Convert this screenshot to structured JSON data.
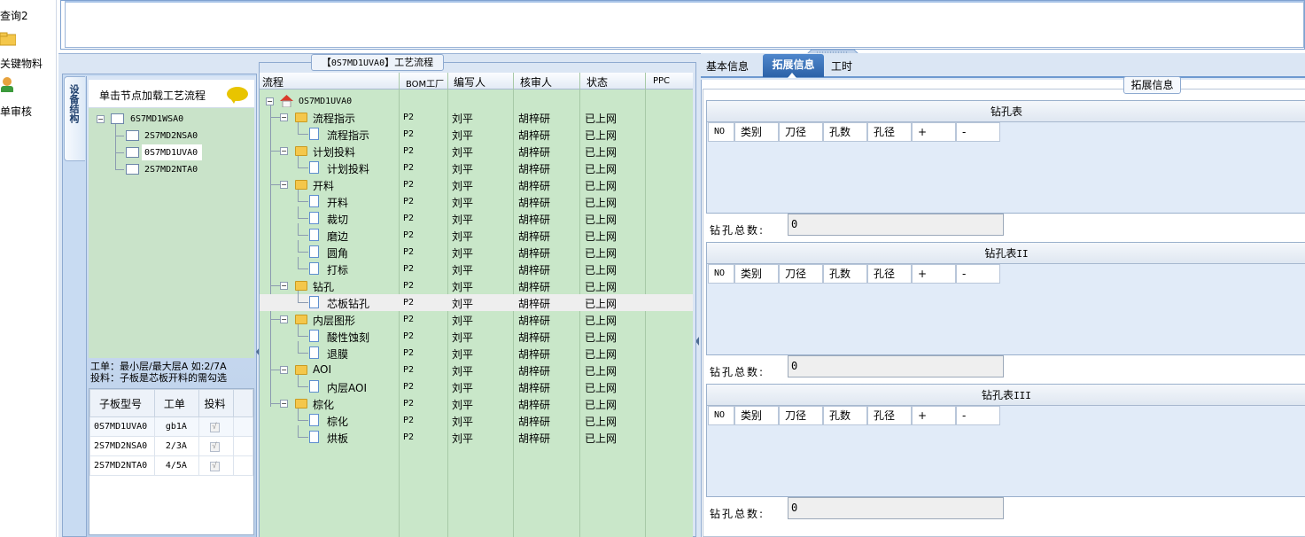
{
  "nav": {
    "items": [
      {
        "label": "查询2",
        "icon": "search-icon"
      },
      {
        "label": "关键物料",
        "icon": "folder-icon"
      },
      {
        "label": "单审核",
        "icon": "user-icon"
      }
    ]
  },
  "left_panel": {
    "vertical_tab": "设备结构",
    "hint": "单击节点加载工艺流程",
    "tree": {
      "root": "6S7MD1WSA0",
      "children": [
        "2S7MD2NSA0",
        "0S7MD1UVA0",
        "2S7MD2NTA0"
      ]
    },
    "note_line1": "工单：最小层/最大层A 如:2/7A",
    "note_line2": "投料：子板是芯板开料的需勾选",
    "table": {
      "headers": [
        "子板型号",
        "工单",
        "投料"
      ],
      "rows": [
        {
          "model": "0S7MD1UVA0",
          "order": "gb1A",
          "feed": "√"
        },
        {
          "model": "2S7MD2NSA0",
          "order": "2/3A",
          "feed": "√"
        },
        {
          "model": "2S7MD2NTA0",
          "order": "4/5A",
          "feed": "√"
        }
      ]
    }
  },
  "mid_panel": {
    "title_prefix": "【",
    "title_code": "0S7MD1UVA0",
    "title_suffix": "】工艺流程",
    "columns": [
      "流程",
      "BOM工厂",
      "编写人",
      "核审人",
      "状态",
      "PPC"
    ],
    "root": "OS7MD1UVA0",
    "rows": [
      {
        "name": "流程指示",
        "bom": "P2",
        "writer": "刘平",
        "reviewer": "胡梓研",
        "status": "已上网"
      },
      {
        "name": "流程指示",
        "bom": "P2",
        "writer": "刘平",
        "reviewer": "胡梓研",
        "status": "已上网"
      },
      {
        "name": "计划投料",
        "bom": "P2",
        "writer": "刘平",
        "reviewer": "胡梓研",
        "status": "已上网"
      },
      {
        "name": "计划投料",
        "bom": "P2",
        "writer": "刘平",
        "reviewer": "胡梓研",
        "status": "已上网"
      },
      {
        "name": "开料",
        "bom": "P2",
        "writer": "刘平",
        "reviewer": "胡梓研",
        "status": "已上网"
      },
      {
        "name": "开料",
        "bom": "P2",
        "writer": "刘平",
        "reviewer": "胡梓研",
        "status": "已上网"
      },
      {
        "name": "裁切",
        "bom": "P2",
        "writer": "刘平",
        "reviewer": "胡梓研",
        "status": "已上网"
      },
      {
        "name": "磨边",
        "bom": "P2",
        "writer": "刘平",
        "reviewer": "胡梓研",
        "status": "已上网"
      },
      {
        "name": "圆角",
        "bom": "P2",
        "writer": "刘平",
        "reviewer": "胡梓研",
        "status": "已上网"
      },
      {
        "name": "打标",
        "bom": "P2",
        "writer": "刘平",
        "reviewer": "胡梓研",
        "status": "已上网"
      },
      {
        "name": "钻孔",
        "bom": "P2",
        "writer": "刘平",
        "reviewer": "胡梓研",
        "status": "已上网"
      },
      {
        "name": "芯板钻孔",
        "bom": "P2",
        "writer": "刘平",
        "reviewer": "胡梓研",
        "status": "已上网"
      },
      {
        "name": "内层图形",
        "bom": "P2",
        "writer": "刘平",
        "reviewer": "胡梓研",
        "status": "已上网"
      },
      {
        "name": "酸性蚀刻",
        "bom": "P2",
        "writer": "刘平",
        "reviewer": "胡梓研",
        "status": "已上网"
      },
      {
        "name": "退膜",
        "bom": "P2",
        "writer": "刘平",
        "reviewer": "胡梓研",
        "status": "已上网"
      },
      {
        "name": "AOI",
        "bom": "P2",
        "writer": "刘平",
        "reviewer": "胡梓研",
        "status": "已上网"
      },
      {
        "name": "内层AOI",
        "bom": "P2",
        "writer": "刘平",
        "reviewer": "胡梓研",
        "status": "已上网"
      },
      {
        "name": "棕化",
        "bom": "P2",
        "writer": "刘平",
        "reviewer": "胡梓研",
        "status": "已上网"
      },
      {
        "name": "棕化",
        "bom": "P2",
        "writer": "刘平",
        "reviewer": "胡梓研",
        "status": "已上网"
      },
      {
        "name": "烘板",
        "bom": "P2",
        "writer": "刘平",
        "reviewer": "胡梓研",
        "status": "已上网"
      }
    ]
  },
  "right_panel": {
    "tabs": [
      "基本信息",
      "拓展信息",
      "工时"
    ],
    "active_tab": "拓展信息",
    "group_title": "拓展信息",
    "columns": [
      "NO",
      "类别",
      "刀径",
      "孔数",
      "孔径",
      "+",
      "-"
    ],
    "total_label": "钻孔总数:",
    "sections": [
      {
        "title": "钻孔表",
        "suffix": "",
        "total": "0"
      },
      {
        "title": "钻孔表",
        "suffix": "II",
        "total": "0"
      },
      {
        "title": "钻孔表",
        "suffix": "III",
        "total": "0"
      }
    ]
  },
  "colors": {
    "accent": "#2c62a8",
    "grid_bg": "#c9e7c9",
    "panel_bg": "#dbe6f4"
  }
}
